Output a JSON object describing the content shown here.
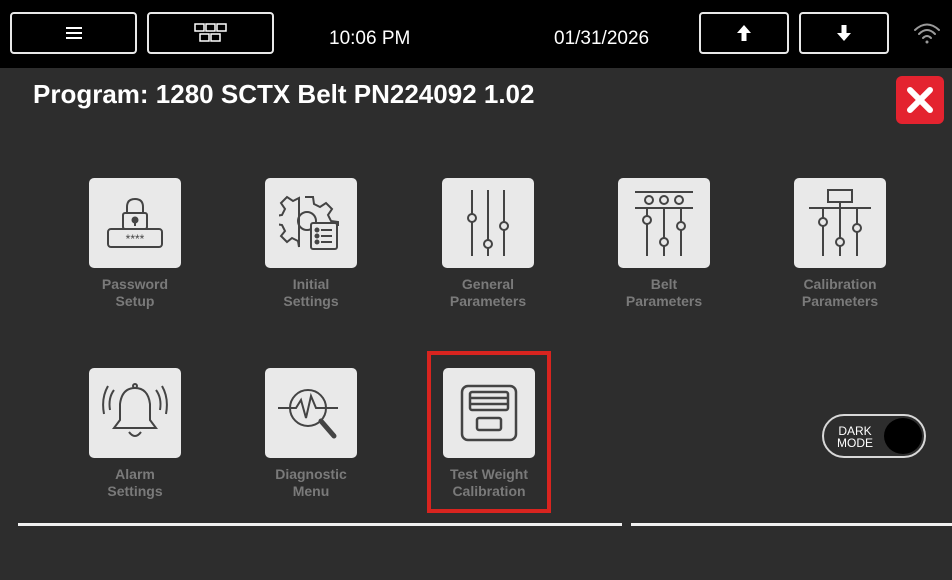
{
  "topbar": {
    "time": "10:06 PM",
    "date": "01/31/2026",
    "menu_icon": "hamburger-menu-icon",
    "layout_icon": "layout-grid-icon",
    "up_icon": "arrow-up-icon",
    "down_icon": "arrow-down-icon",
    "wifi_icon": "wifi-icon"
  },
  "header": {
    "program_title": "Program: 1280 SCTX Belt PN224092 1.02",
    "close_icon": "close-x-icon"
  },
  "tiles": [
    {
      "line1": "Password",
      "line2": "Setup",
      "icon": "password-lock-icon"
    },
    {
      "line1": "Initial",
      "line2": "Settings",
      "icon": "gear-settings-icon"
    },
    {
      "line1": "General",
      "line2": "Parameters",
      "icon": "sliders-icon"
    },
    {
      "line1": "Belt",
      "line2": "Parameters",
      "icon": "belt-sliders-icon"
    },
    {
      "line1": "Calibration",
      "line2": "Parameters",
      "icon": "calibration-sliders-icon"
    },
    {
      "line1": "Alarm",
      "line2": "Settings",
      "icon": "alarm-bell-icon"
    },
    {
      "line1": "Diagnostic",
      "line2": "Menu",
      "icon": "diagnostic-magnifier-icon"
    },
    {
      "line1": "Test Weight",
      "line2": "Calibration",
      "icon": "test-weight-scale-icon"
    }
  ],
  "dark_mode": {
    "line1": "DARK",
    "line2": "MODE",
    "enabled": true
  },
  "colors": {
    "accent_red": "#e4232f",
    "tile_bg": "#e9e9e9",
    "background": "#2d2d2d"
  }
}
